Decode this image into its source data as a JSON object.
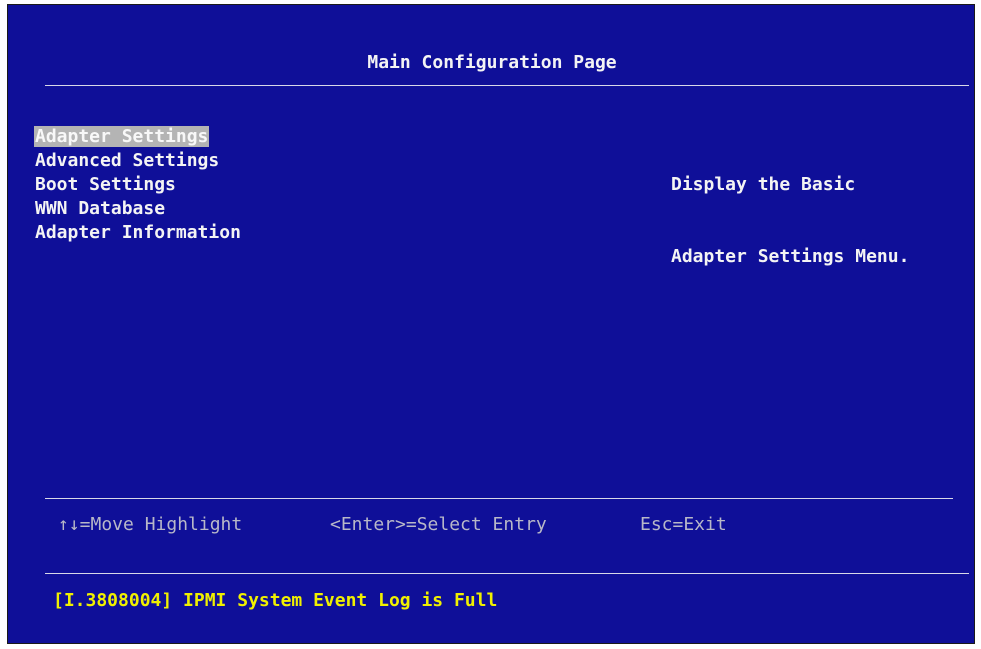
{
  "page": {
    "title": "Main Configuration Page"
  },
  "menu": {
    "items": [
      {
        "label": "Adapter Settings"
      },
      {
        "label": "Advanced Settings"
      },
      {
        "label": "Boot Settings"
      },
      {
        "label": "WWN Database"
      },
      {
        "label": "Adapter Information"
      }
    ],
    "selected": "Adapter Settings"
  },
  "help": {
    "line1": "Display the Basic",
    "line2": "Adapter Settings Menu."
  },
  "keys": {
    "move": "↑↓=Move Highlight",
    "enter": "<Enter>=Select Entry",
    "esc": "Esc=Exit"
  },
  "status": {
    "message": "[I.3808004] IPMI System Event Log is Full"
  },
  "colors": {
    "background": "#0f0f98",
    "text": "#f4f4f4",
    "highlight": "#b4b4b4",
    "key_hint": "#b8b8c8",
    "status": "#f0f000"
  }
}
